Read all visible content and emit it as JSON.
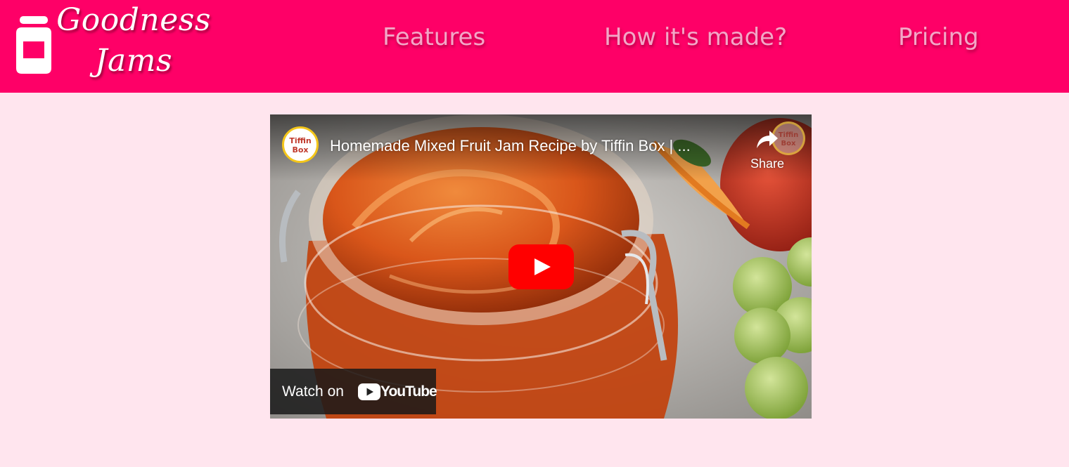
{
  "header": {
    "brand_line1": "Goodness",
    "brand_line2": "Jams",
    "nav": [
      {
        "label": "Features"
      },
      {
        "label": "How it's made?"
      },
      {
        "label": "Pricing"
      }
    ],
    "background_color": "#fe0067",
    "icon": "jar-icon"
  },
  "video": {
    "channel_avatar_text": "Tiffin Box",
    "title": "Homemade Mixed Fruit Jam Recipe by Tiffin Box | ...",
    "share_label": "Share",
    "watch_on_label": "Watch on",
    "youtube_wordmark": "YouTube",
    "play_button_color": "#ff0000"
  },
  "page": {
    "background_color": "#ffe5ee"
  }
}
